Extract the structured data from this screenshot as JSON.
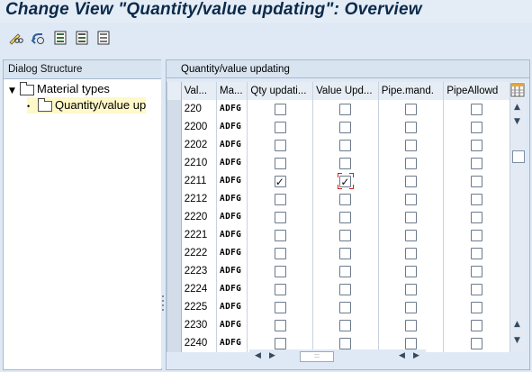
{
  "title": "Change View \"Quantity/value updating\": Overview",
  "toolbar": {
    "icons": [
      "pencil-glasses-icon",
      "undo-icon",
      "select-all-icon",
      "select-block-icon",
      "deselect-all-icon"
    ]
  },
  "left_pane": {
    "header": "Dialog Structure",
    "tree": [
      {
        "label": "Material types",
        "expanded": true
      },
      {
        "label": "Quantity/value up",
        "selected": true
      }
    ]
  },
  "right_pane": {
    "header": "Quantity/value updating",
    "columns": [
      "Val...",
      "Ma...",
      "Qty updati...",
      "Value Upd...",
      "Pipe.mand.",
      "PipeAllowd"
    ],
    "rows": [
      {
        "val": "220",
        "ma": "ADFG",
        "qty": false,
        "value": false,
        "pipe": false,
        "pipeallow": false
      },
      {
        "val": "2200",
        "ma": "ADFG",
        "qty": false,
        "value": false,
        "pipe": false,
        "pipeallow": false
      },
      {
        "val": "2202",
        "ma": "ADFG",
        "qty": false,
        "value": false,
        "pipe": false,
        "pipeallow": false
      },
      {
        "val": "2210",
        "ma": "ADFG",
        "qty": false,
        "value": false,
        "pipe": false,
        "pipeallow": false
      },
      {
        "val": "2211",
        "ma": "ADFG",
        "qty": true,
        "value": true,
        "pipe": false,
        "pipeallow": false
      },
      {
        "val": "2212",
        "ma": "ADFG",
        "qty": false,
        "value": false,
        "pipe": false,
        "pipeallow": false
      },
      {
        "val": "2220",
        "ma": "ADFG",
        "qty": false,
        "value": false,
        "pipe": false,
        "pipeallow": false
      },
      {
        "val": "2221",
        "ma": "ADFG",
        "qty": false,
        "value": false,
        "pipe": false,
        "pipeallow": false
      },
      {
        "val": "2222",
        "ma": "ADFG",
        "qty": false,
        "value": false,
        "pipe": false,
        "pipeallow": false
      },
      {
        "val": "2223",
        "ma": "ADFG",
        "qty": false,
        "value": false,
        "pipe": false,
        "pipeallow": false
      },
      {
        "val": "2224",
        "ma": "ADFG",
        "qty": false,
        "value": false,
        "pipe": false,
        "pipeallow": false
      },
      {
        "val": "2225",
        "ma": "ADFG",
        "qty": false,
        "value": false,
        "pipe": false,
        "pipeallow": false
      },
      {
        "val": "2230",
        "ma": "ADFG",
        "qty": false,
        "value": false,
        "pipe": false,
        "pipeallow": false
      },
      {
        "val": "2240",
        "ma": "ADFG",
        "qty": false,
        "value": false,
        "pipe": false,
        "pipeallow": false
      }
    ]
  },
  "colors": {
    "title": "#0b2a4a",
    "focus": "#d02020",
    "pane_bg": "#dfe9f5"
  }
}
